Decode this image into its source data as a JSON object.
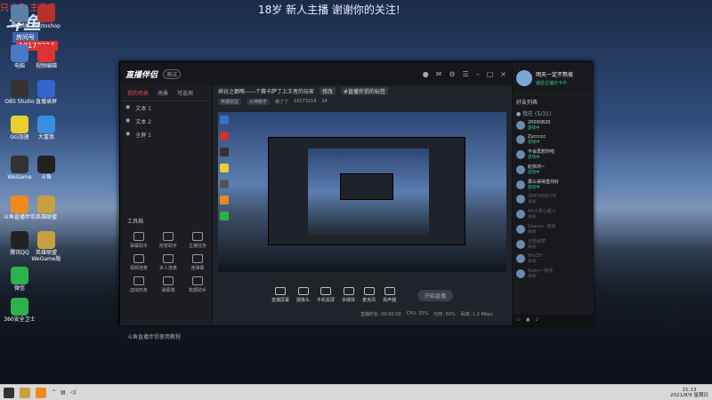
{
  "overlay": {
    "top_left": "只斗鱼 主播房",
    "banner": "18岁 新人主播 谢谢你的关注!",
    "room_badge": "房间号",
    "room_id": "10173216"
  },
  "desktop_icons": [
    {
      "label": "回收站",
      "color": "#5a7fa8"
    },
    {
      "label": "电脑",
      "color": "#4b78c8"
    },
    {
      "label": "OBS Studio",
      "color": "#333"
    },
    {
      "label": "GG加速",
      "color": "#e8d030"
    },
    {
      "label": "WeGame",
      "color": "#333"
    },
    {
      "label": "斗鱼直播伴侣",
      "color": "#f08a1d"
    },
    {
      "label": "腾讯QQ",
      "color": "#222"
    },
    {
      "label": "微信",
      "color": "#2bb24c"
    },
    {
      "label": "360安全卫士",
      "color": "#2bb24c"
    },
    {
      "label": "Photoshop",
      "color": "#b83030"
    },
    {
      "label": "视频编辑",
      "color": "#d33"
    },
    {
      "label": "直播录屏",
      "color": "#3366cc"
    },
    {
      "label": "大富翁",
      "color": "#3a8de0"
    },
    {
      "label": "斗鱼",
      "color": "#222"
    },
    {
      "label": "英雄联盟",
      "color": "#c8a040"
    },
    {
      "label": "英雄联盟WeGame版",
      "color": "#c8a040"
    }
  ],
  "window": {
    "logo": "直播伴侣",
    "version": "测试",
    "scene_tabs": [
      "我的场景",
      "场景",
      "可选项"
    ],
    "scenes": [
      "文本 1",
      "文本 2",
      "全屏 1"
    ],
    "toolbox_title": "工具箱",
    "tools": [
      "弹幕助手",
      "房管助手",
      "主播任务",
      "视频连麦",
      "多人连麦",
      "连弹幕",
      "虚拟形象",
      "弹幕墙",
      "数据助手"
    ],
    "help": "斗鱼直播伴侣使用教程",
    "title": "峡谷之巅略——个赛卡萨丁上王者的玩家",
    "title_chip": "修改",
    "title_tag": "#直播伴侣的标签",
    "sub_game": "英雄联盟",
    "sub_cat": "大神教学",
    "sub_notice": "做了了",
    "sub_room": "10173216",
    "sub_fans": "24",
    "controls": [
      "直播屏幕",
      "摄像头",
      "手机投屏",
      "多媒体",
      "麦克风",
      "扬声器"
    ],
    "go_live": "开始直播",
    "status": [
      "直播时长: 00:00:00",
      "CPU: 25%",
      "内存: 50%",
      "码率: 1.2 Mbps"
    ]
  },
  "right_panel": {
    "name": "明天一定不熬夜",
    "tag": "诚信主播打卡中",
    "title": "好友列表",
    "group": "● 我在 (5/31)",
    "friends": [
      {
        "name": "20090820",
        "status": "游戏中",
        "online": true
      },
      {
        "name": "Zyccccc",
        "status": "游戏中",
        "online": true
      },
      {
        "name": "不会再想你啦",
        "status": "游戏中",
        "online": true
      },
      {
        "name": "赵依鸿~",
        "status": "游戏中",
        "online": true
      },
      {
        "name": "那么得得直你好",
        "status": "游戏中",
        "online": true
      },
      {
        "name": "2843458729",
        "status": "离线",
        "online": false
      },
      {
        "name": "AK大哥心超人",
        "status": "离线",
        "online": false
      },
      {
        "name": "Season· 夜夜",
        "status": "离线",
        "online": false
      },
      {
        "name": "记愿余梦",
        "status": "离线",
        "online": false
      },
      {
        "name": "SkyZH",
        "status": "离线",
        "online": false
      },
      {
        "name": "Ruby~ 阿花",
        "status": "离线",
        "online": false
      }
    ]
  },
  "taskbar": {
    "time": "21:13",
    "date": "2021/8/9 星期日"
  }
}
